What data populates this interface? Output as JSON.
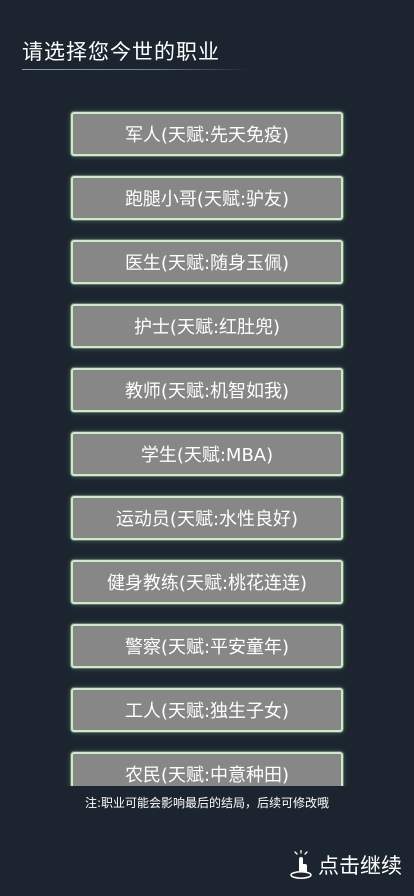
{
  "header": {
    "title": "请选择您今世的职业"
  },
  "choices": [
    "军人(天赋:先天免疫)",
    "跑腿小哥(天赋:驴友)",
    "医生(天赋:随身玉佩)",
    "护士(天赋:红肚兜)",
    "教师(天赋:机智如我)",
    "学生(天赋:MBA)",
    "运动员(天赋:水性良好)",
    "健身教练(天赋:桃花连连)",
    "警察(天赋:平安童年)",
    "工人(天赋:独生子女)",
    "农民(天赋:中意种田)"
  ],
  "footer": {
    "note": "注:职业可能会影响最后的结局，后续可修改哦",
    "continue_label": "点击继续",
    "continue_icon": "tap-hand-icon"
  }
}
